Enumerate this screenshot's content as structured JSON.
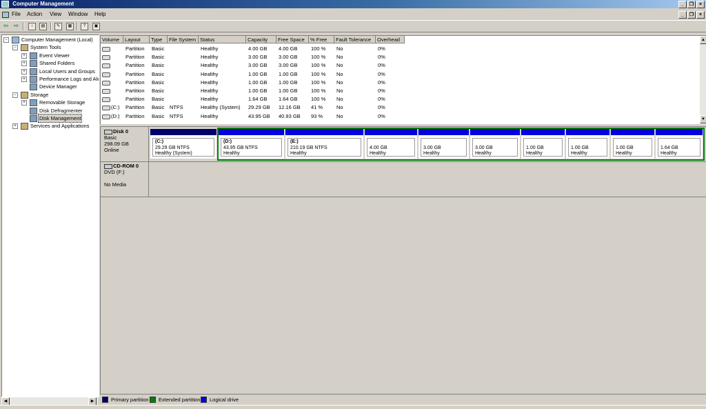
{
  "window": {
    "title": "Computer Management",
    "min": "_",
    "restore": "❐",
    "close": "×"
  },
  "menu": [
    "File",
    "Action",
    "View",
    "Window",
    "Help"
  ],
  "tree": [
    {
      "label": "Computer Management (Local)",
      "level": 0,
      "expander": "−",
      "icon": "computer-icon"
    },
    {
      "label": "System Tools",
      "level": 1,
      "expander": "−",
      "icon": "tools-icon"
    },
    {
      "label": "Event Viewer",
      "level": 2,
      "expander": "+",
      "icon": "event-viewer-icon"
    },
    {
      "label": "Shared Folders",
      "level": 2,
      "expander": "+",
      "icon": "folder-icon"
    },
    {
      "label": "Local Users and Groups",
      "level": 2,
      "expander": "+",
      "icon": "users-icon"
    },
    {
      "label": "Performance Logs and Alerts",
      "level": 2,
      "expander": "+",
      "icon": "performance-icon"
    },
    {
      "label": "Device Manager",
      "level": 2,
      "expander": "",
      "icon": "device-manager-icon"
    },
    {
      "label": "Storage",
      "level": 1,
      "expander": "−",
      "icon": "storage-icon"
    },
    {
      "label": "Removable Storage",
      "level": 2,
      "expander": "+",
      "icon": "removable-storage-icon"
    },
    {
      "label": "Disk Defragmenter",
      "level": 2,
      "expander": "",
      "icon": "defrag-icon"
    },
    {
      "label": "Disk Management",
      "level": 2,
      "expander": "",
      "icon": "disk-management-icon",
      "selected": true
    },
    {
      "label": "Services and Applications",
      "level": 1,
      "expander": "+",
      "icon": "services-icon"
    }
  ],
  "volume_table": {
    "columns": [
      "Volume",
      "Layout",
      "Type",
      "File System",
      "Status",
      "Capacity",
      "Free Space",
      "% Free",
      "Fault Tolerance",
      "Overhead"
    ],
    "rows": [
      [
        "",
        "Partition",
        "Basic",
        "",
        "Healthy",
        "4.00 GB",
        "4.00 GB",
        "100 %",
        "No",
        "0%"
      ],
      [
        "",
        "Partition",
        "Basic",
        "",
        "Healthy",
        "3.00 GB",
        "3.00 GB",
        "100 %",
        "No",
        "0%"
      ],
      [
        "",
        "Partition",
        "Basic",
        "",
        "Healthy",
        "3.00 GB",
        "3.00 GB",
        "100 %",
        "No",
        "0%"
      ],
      [
        "",
        "Partition",
        "Basic",
        "",
        "Healthy",
        "1.00 GB",
        "1.00 GB",
        "100 %",
        "No",
        "0%"
      ],
      [
        "",
        "Partition",
        "Basic",
        "",
        "Healthy",
        "1.00 GB",
        "1.00 GB",
        "100 %",
        "No",
        "0%"
      ],
      [
        "",
        "Partition",
        "Basic",
        "",
        "Healthy",
        "1.00 GB",
        "1.00 GB",
        "100 %",
        "No",
        "0%"
      ],
      [
        "",
        "Partition",
        "Basic",
        "",
        "Healthy",
        "1.64 GB",
        "1.64 GB",
        "100 %",
        "No",
        "0%"
      ],
      [
        "(C:)",
        "Partition",
        "Basic",
        "NTFS",
        "Healthy (System)",
        "29.29 GB",
        "12.16 GB",
        "41 %",
        "No",
        "0%"
      ],
      [
        "(D:)",
        "Partition",
        "Basic",
        "NTFS",
        "Healthy",
        "43.95 GB",
        "40.93 GB",
        "93 %",
        "No",
        "0%"
      ]
    ]
  },
  "disks": [
    {
      "name": "Disk 0",
      "details": [
        "Basic",
        "298.09 GB",
        "Online"
      ],
      "partitions": [
        {
          "label": "(C:)",
          "size": "29.29 GB NTFS",
          "status": "Healthy (System)",
          "kind": "primary"
        },
        {
          "label": "(D:)",
          "size": "43.95 GB NTFS",
          "status": "Healthy",
          "kind": "logical"
        },
        {
          "label": "(E:)",
          "size": "210.19 GB NTFS",
          "status": "Healthy",
          "kind": "logical"
        },
        {
          "label": "",
          "size": "4.00 GB",
          "status": "Healthy",
          "kind": "logical"
        },
        {
          "label": "",
          "size": "3.00 GB",
          "status": "Healthy",
          "kind": "logical"
        },
        {
          "label": "",
          "size": "3.00 GB",
          "status": "Healthy",
          "kind": "logical"
        },
        {
          "label": "",
          "size": "1.00 GB",
          "status": "Healthy",
          "kind": "logical"
        },
        {
          "label": "",
          "size": "1.00 GB",
          "status": "Healthy",
          "kind": "logical"
        },
        {
          "label": "",
          "size": "1.00 GB",
          "status": "Healthy",
          "kind": "logical"
        },
        {
          "label": "",
          "size": "1.64 GB",
          "status": "Healthy",
          "kind": "logical"
        }
      ]
    },
    {
      "name": "CD-ROM 0",
      "details": [
        "DVD (F:)",
        "",
        "No Media"
      ],
      "partitions": []
    }
  ],
  "legend": [
    {
      "label": "Primary partition",
      "color": "#00006a"
    },
    {
      "label": "Extended partition",
      "color": "#008000"
    },
    {
      "label": "Logical drive",
      "color": "#0000e0"
    }
  ]
}
